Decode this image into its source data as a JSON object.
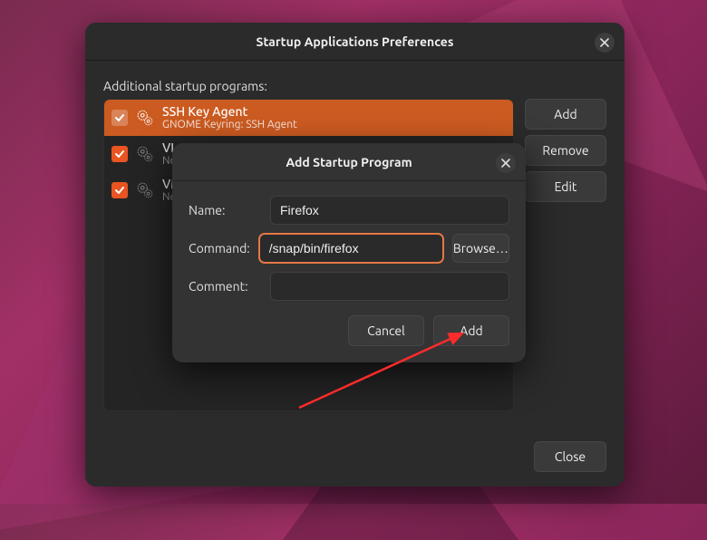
{
  "prefs": {
    "title": "Startup Applications Preferences",
    "section_label": "Additional startup programs:",
    "buttons": {
      "add": "Add",
      "remove": "Remove",
      "edit": "Edit",
      "close": "Close"
    },
    "items": [
      {
        "title": "SSH Key Agent",
        "subtitle": "GNOME Keyring: SSH Agent",
        "checked": true,
        "selected": true
      },
      {
        "title": "VL",
        "subtitle": "No",
        "checked": true,
        "selected": false
      },
      {
        "title": "VM",
        "subtitle": "No",
        "checked": true,
        "selected": false
      }
    ]
  },
  "dialog": {
    "title": "Add Startup Program",
    "labels": {
      "name": "Name:",
      "command": "Command:",
      "comment": "Comment:",
      "browse": "Browse…",
      "cancel": "Cancel",
      "add": "Add"
    },
    "values": {
      "name": "Firefox",
      "command": "/snap/bin/firefox",
      "comment": ""
    }
  },
  "icons": {
    "close": "close-icon",
    "gear": "gear-icon",
    "check": "check-icon"
  }
}
